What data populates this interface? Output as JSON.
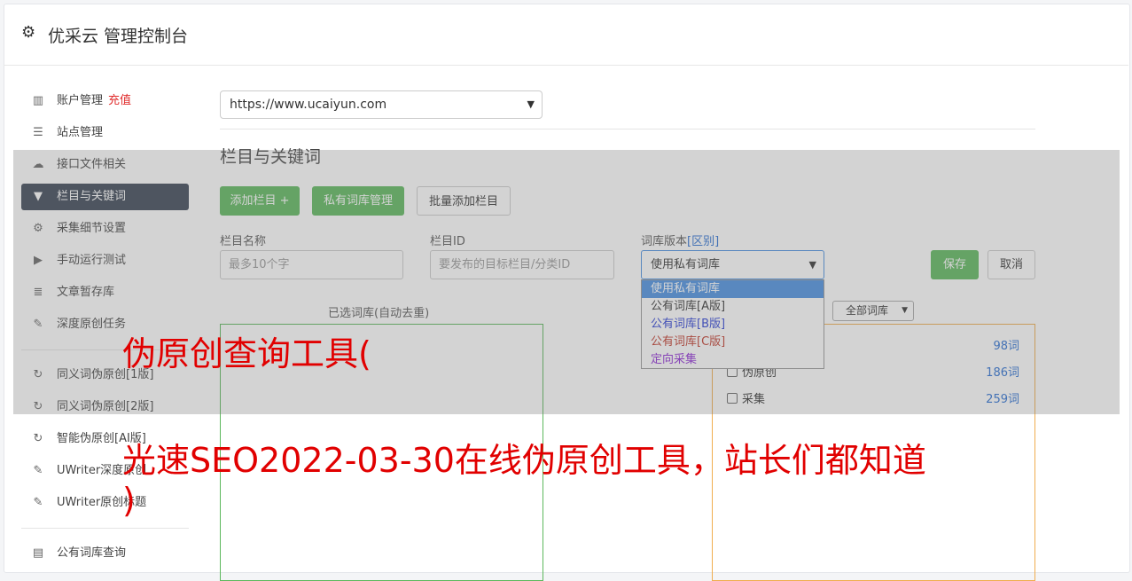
{
  "header": {
    "title": "优采云 管理控制台",
    "icon": "gear-icon"
  },
  "sidebar": {
    "items": [
      {
        "label": "账户管理",
        "extra": "充值",
        "icon": "bar-chart-icon"
      },
      {
        "label": "站点管理",
        "icon": "server-icon"
      },
      {
        "label": "接口文件相关",
        "icon": "cloud-upload-icon"
      },
      {
        "label": "栏目与关键词",
        "icon": "filter-icon",
        "active": true
      },
      {
        "label": "采集细节设置",
        "icon": "cogs-icon"
      },
      {
        "label": "手动运行测试",
        "icon": "play-icon"
      },
      {
        "label": "文章暂存库",
        "icon": "database-icon"
      },
      {
        "label": "深度原创任务",
        "icon": "edit-icon"
      },
      {
        "label": "同义词伪原创[1版]",
        "icon": "refresh-icon"
      },
      {
        "label": "同义词伪原创[2版]",
        "icon": "refresh-icon"
      },
      {
        "label": "智能伪原创[AI版]",
        "icon": "refresh-icon"
      },
      {
        "label": "UWriter深度原创",
        "icon": "edit-icon"
      },
      {
        "label": "UWriter原创标题",
        "icon": "edit-icon"
      },
      {
        "label": "公有词库查询",
        "icon": "book-icon"
      }
    ]
  },
  "main": {
    "site_select": "https://www.ucaiyun.com",
    "section_title": "栏目与关键词",
    "buttons": {
      "add_column": "添加栏目 +",
      "private_lib": "私有词库管理",
      "batch_add": "批量添加栏目"
    },
    "fields": {
      "column_name_label": "栏目名称",
      "column_name_placeholder": "最多10个字",
      "column_id_label": "栏目ID",
      "column_id_placeholder": "要发布的目标栏目/分类ID",
      "lib_version_label": "词库版本",
      "lib_version_link": "[区别]",
      "lib_version_value": "使用私有词库"
    },
    "save": "保存",
    "cancel": "取消",
    "chosen_label": "已选词库(自动去重)",
    "all_libs_select": "全部词库",
    "dropdown_options": [
      {
        "label": "使用私有词库",
        "color": "#ffffff",
        "selected": true
      },
      {
        "label": "公有词库[A版]",
        "color": "#333333"
      },
      {
        "label": "公有词库[B版]",
        "color": "#2b3fd6"
      },
      {
        "label": "公有词库[C版]",
        "color": "#c0392b"
      },
      {
        "label": "定向采集",
        "color": "#8e2bd6"
      }
    ],
    "lib_rows": [
      {
        "label": "",
        "count": "98词",
        "checkbox": false
      },
      {
        "label": "伪原创",
        "count": "186词",
        "checkbox": true
      },
      {
        "label": "采集",
        "count": "259词",
        "checkbox": true
      }
    ]
  },
  "overlay_text": {
    "line1": "伪原创查询工具(",
    "line2": "光速SEO2022-03-30在线伪原创工具，站长们都知道",
    "line3": ")"
  },
  "colors": {
    "accent_green": "#5cb85c",
    "active_nav": "#3a4454",
    "overlay_red": "#e10000",
    "link_blue": "#2a6fd3"
  }
}
